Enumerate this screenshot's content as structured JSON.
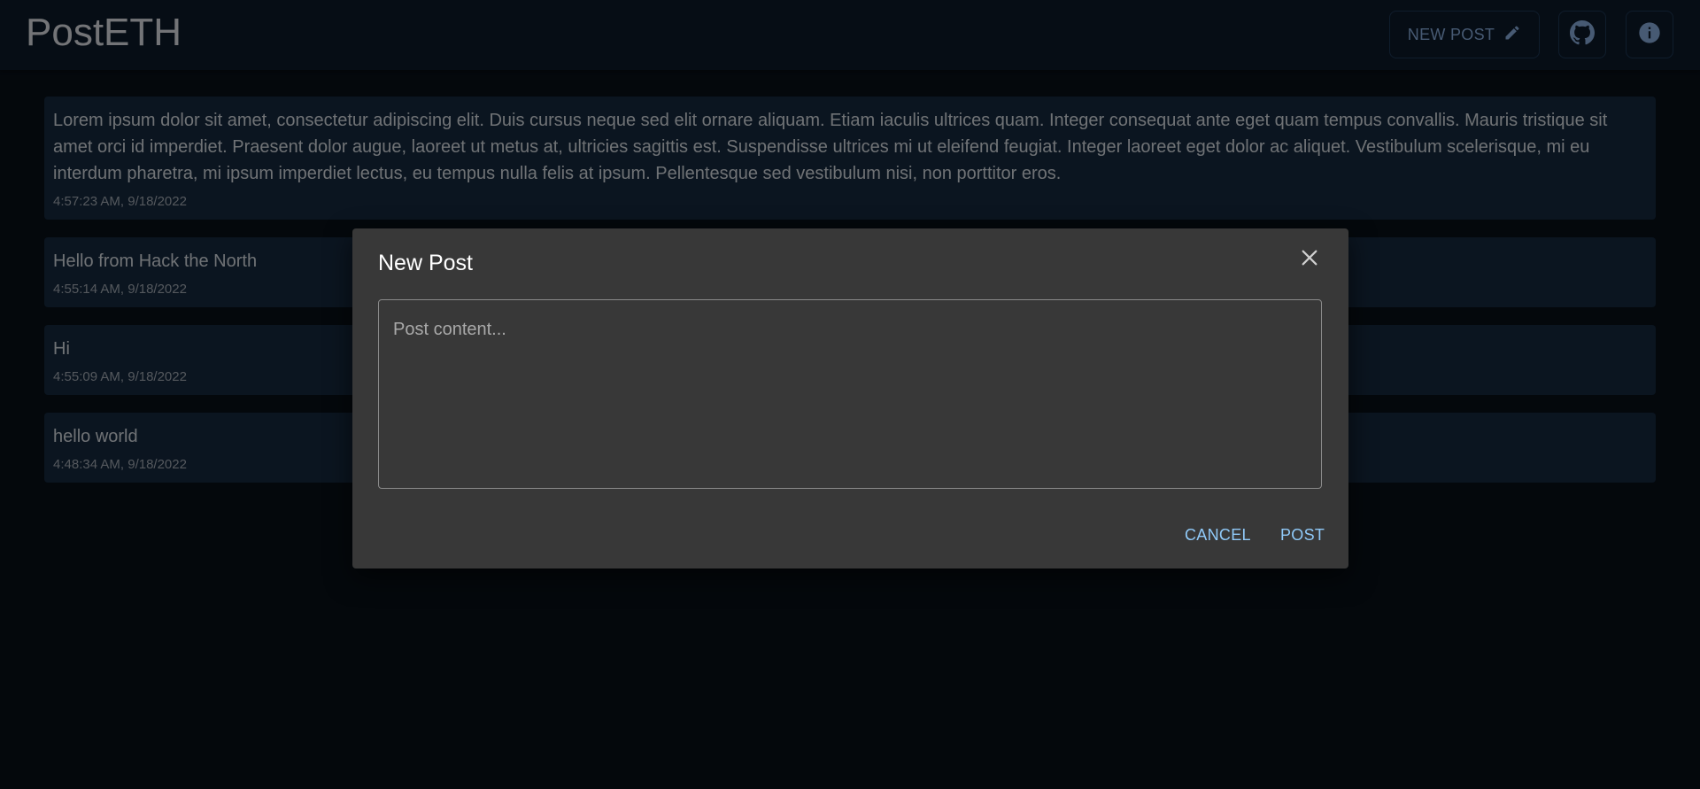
{
  "app": {
    "title": "PostETH",
    "new_post_label": "NEW POST",
    "icons": {
      "edit": "pencil-icon",
      "github": "github-icon",
      "info": "info-icon"
    }
  },
  "posts": [
    {
      "body": "Lorem ipsum dolor sit amet, consectetur adipiscing elit. Duis cursus neque sed elit ornare aliquam. Etiam iaculis ultrices quam. Integer consequat ante eget quam tempus convallis. Mauris tristique sit amet orci id imperdiet. Praesent dolor augue, laoreet ut metus at, ultricies sagittis est. Suspendisse ultrices mi ut eleifend feugiat. Integer laoreet eget dolor ac aliquet. Vestibulum scelerisque, mi eu interdum pharetra, mi ipsum imperdiet lectus, eu tempus nulla felis at ipsum. Pellentesque sed vestibulum nisi, non porttitor eros.",
      "time": "4:57:23 AM, 9/18/2022"
    },
    {
      "body": "Hello from Hack the North",
      "time": "4:55:14 AM, 9/18/2022"
    },
    {
      "body": "Hi",
      "time": "4:55:09 AM, 9/18/2022"
    },
    {
      "body": "hello world",
      "time": "4:48:34 AM, 9/18/2022"
    }
  ],
  "dialog": {
    "title": "New Post",
    "placeholder": "Post content...",
    "value": "",
    "cancel_label": "CANCEL",
    "post_label": "POST"
  },
  "colors": {
    "background": "#081019",
    "topbar": "#0d1a2a",
    "card": "#162a40",
    "dialog": "#383838",
    "accent": "#90caf9"
  }
}
